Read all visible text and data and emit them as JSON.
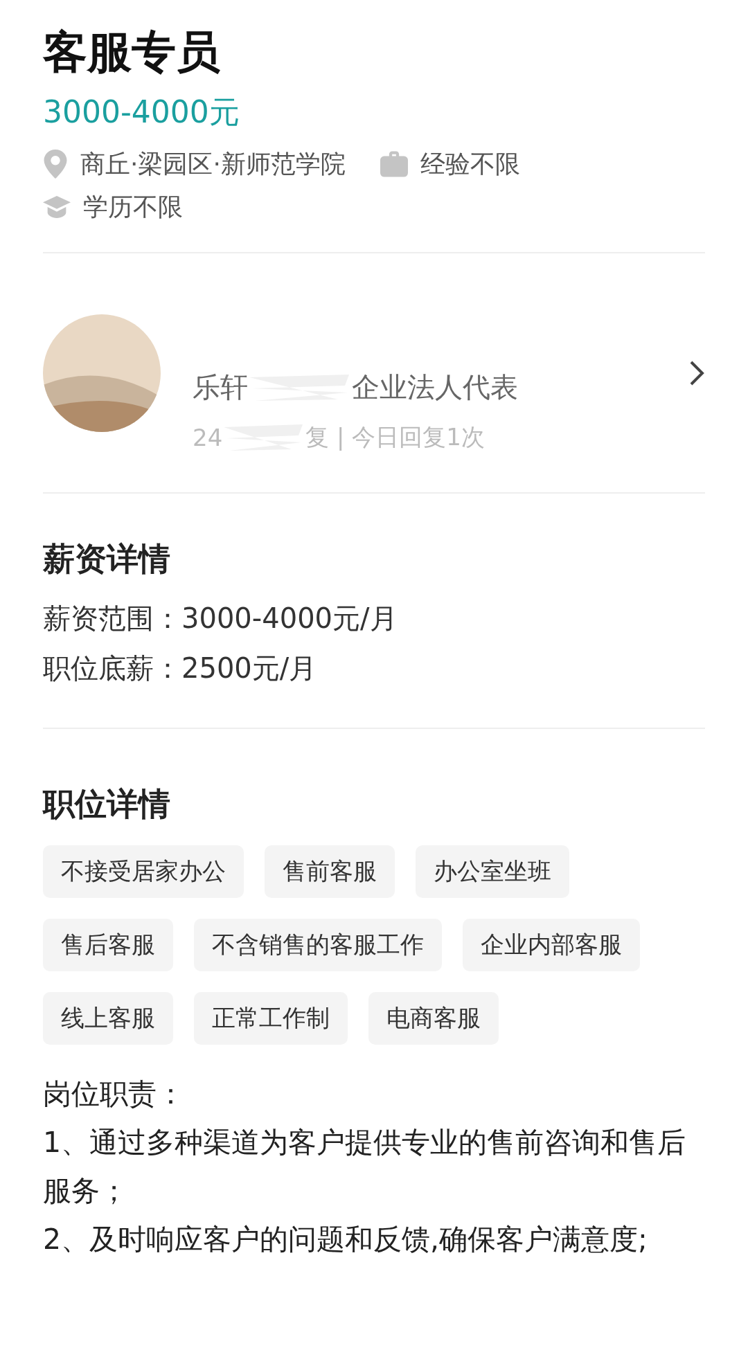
{
  "job": {
    "title": "客服专员",
    "salary": "3000-4000元",
    "meta": [
      {
        "kind": "location",
        "text": "商丘·梁园区·新师范学院"
      },
      {
        "kind": "experience",
        "text": "经验不限"
      },
      {
        "kind": "education",
        "text": "学历不限"
      }
    ]
  },
  "recruiter": {
    "name": "乐轩",
    "role": "企业法人代表",
    "reply_time": "24",
    "reply_info": "复 | 今日回复1次"
  },
  "salary_details": {
    "heading": "薪资详情",
    "lines": [
      "薪资范围：3000-4000元/月",
      "职位底薪：2500元/月"
    ]
  },
  "job_details": {
    "heading": "职位详情",
    "tags": [
      "不接受居家办公",
      "售前客服",
      "办公室坐班",
      "售后客服",
      "不含销售的客服工作",
      "企业内部客服",
      "线上客服",
      "正常工作制",
      "电商客服"
    ],
    "description": [
      "岗位职责：",
      "1、通过多种渠道为客户提供专业的售前咨询和售后服务；",
      "2、及时响应客户的问题和反馈,确保客户满意度;"
    ]
  }
}
